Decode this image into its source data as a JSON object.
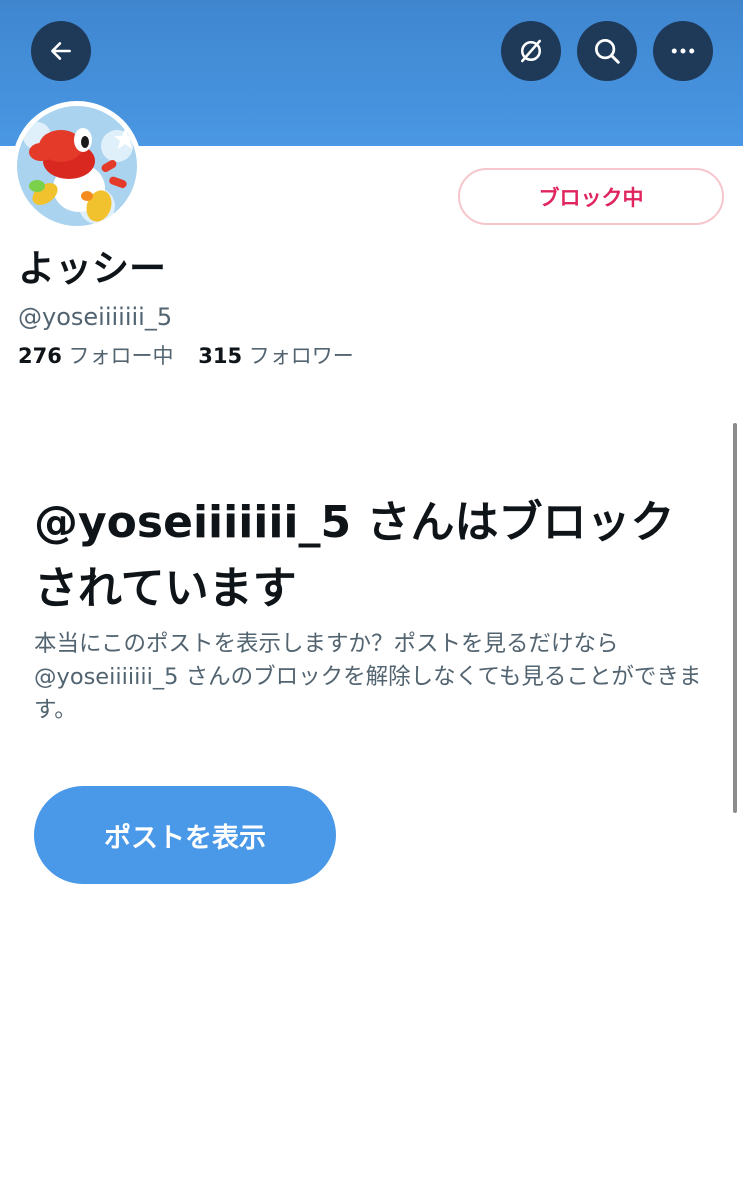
{
  "header": {
    "back_icon": "arrow-left-icon",
    "hide_icon": "eye-slash-icon",
    "search_icon": "search-icon",
    "more_icon": "more-horizontal-icon",
    "banner_color": "#4a97e3",
    "button_color": "#1e3a58"
  },
  "profile": {
    "avatar_icon": "yoshi-avatar",
    "display_name": "よッシー",
    "handle": "@yoseiiiiiii_5",
    "following_count": "276",
    "following_label": "フォロー中",
    "followers_count": "315",
    "followers_label": "フォロワー",
    "blocked_button_label": "ブロック中",
    "blocked_color": "#e0245e"
  },
  "blocked_notice": {
    "title": "@yoseiiiiiii_5 さんはブロックされています",
    "description": "本当にこのポストを表示しますか？ポストを見るだけなら @yoseiiiiiii_5 さんのブロックを解除しなくても見ることができます。",
    "view_button_label": "ポストを表示",
    "accent_color": "#4a98e8"
  }
}
